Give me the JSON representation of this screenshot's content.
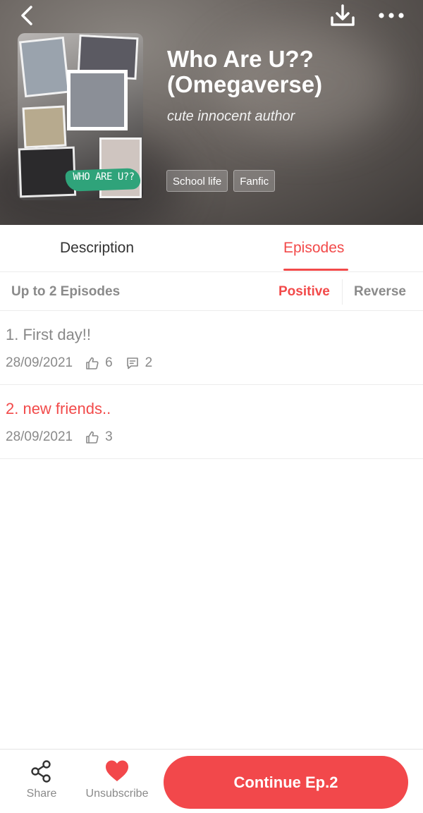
{
  "header": {
    "title": "Who Are U?? (Omegaverse)",
    "author": "cute innocent author",
    "cover_text": "WHO ARE U??",
    "tags": [
      "School life",
      "Fanfic"
    ],
    "icons": {
      "back": "back-arrow-icon",
      "download": "download-icon",
      "more": "more-icon"
    }
  },
  "tabs": {
    "description": "Description",
    "episodes": "Episodes",
    "active": "episodes"
  },
  "sortbar": {
    "count_label": "Up to 2 Episodes",
    "positive": "Positive",
    "reverse": "Reverse",
    "active": "positive"
  },
  "episodes": [
    {
      "title": "1. First day!!",
      "date": "28/09/2021",
      "likes": "6",
      "comments": "2",
      "current": false
    },
    {
      "title": "2. new friends..",
      "date": "28/09/2021",
      "likes": "3",
      "current": true
    }
  ],
  "bottom_bar": {
    "share_label": "Share",
    "unsubscribe_label": "Unsubscribe",
    "continue_label": "Continue Ep.2"
  },
  "colors": {
    "accent": "#f24a4a",
    "muted_text": "#8a8a8a",
    "heart": "#f2484b"
  }
}
